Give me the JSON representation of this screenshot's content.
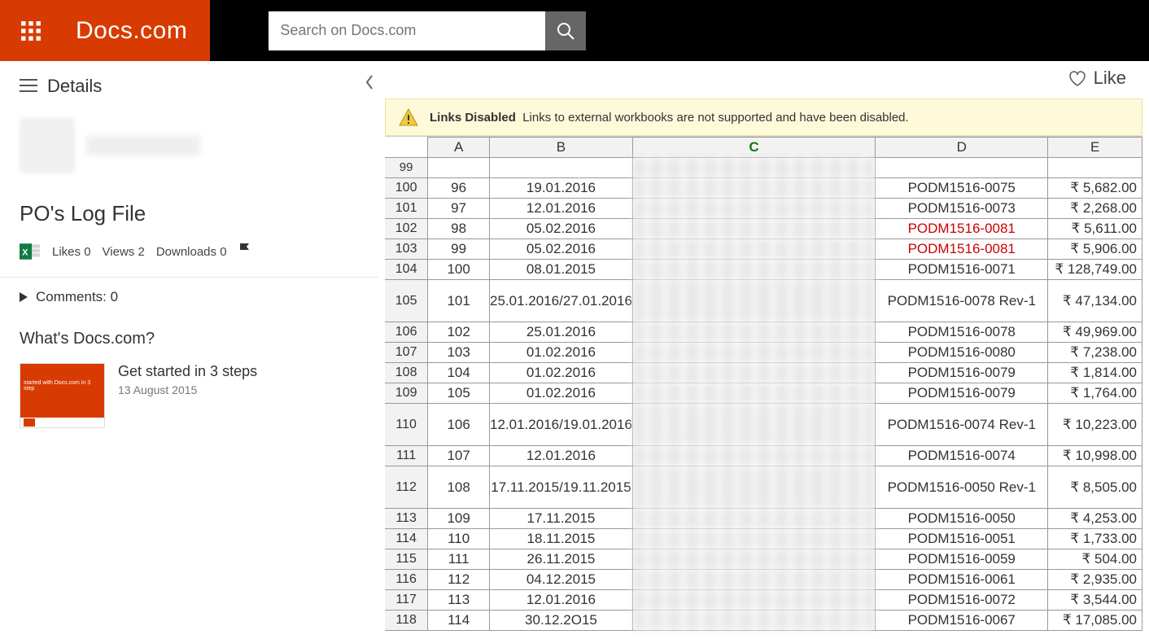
{
  "header": {
    "brand": "Docs.com",
    "search_placeholder": "Search on Docs.com"
  },
  "sidebar": {
    "details_label": "Details",
    "doc_title": "PO's Log File",
    "likes_label": "Likes",
    "likes_count": "0",
    "views_label": "Views",
    "views_count": "2",
    "downloads_label": "Downloads",
    "downloads_count": "0",
    "comments_label": "Comments:",
    "comments_count": "0",
    "whats_label": "What's Docs.com?",
    "promo_title": "Get started in 3 steps",
    "promo_date": "13 August 2015",
    "promo_thumb_text": "started with Docs.com in 3 step"
  },
  "viewer": {
    "like_label": "Like",
    "warning_title": "Links Disabled",
    "warning_text": "Links to external workbooks are not supported and have been disabled."
  },
  "spreadsheet": {
    "columns": [
      "A",
      "B",
      "C",
      "D",
      "E"
    ],
    "rows": [
      {
        "rh": "100",
        "a": "96",
        "b": "19.01.2016",
        "d": "PODM1516-0075",
        "e": "₹ 5,682.00"
      },
      {
        "rh": "101",
        "a": "97",
        "b": "12.01.2016",
        "d": "PODM1516-0073",
        "e": "₹ 2,268.00"
      },
      {
        "rh": "102",
        "a": "98",
        "b": "05.02.2016",
        "d": "PODM1516-0081",
        "e": "₹ 5,611.00",
        "dred": true
      },
      {
        "rh": "103",
        "a": "99",
        "b": "05.02.2016",
        "d": "PODM1516-0081",
        "e": "₹ 5,906.00",
        "dred": true
      },
      {
        "rh": "104",
        "a": "100",
        "b": "08.01.2015",
        "d": "PODM1516-0071",
        "e": "₹ 128,749.00"
      },
      {
        "rh": "105",
        "a": "101",
        "b": "25.01.2016/27.01.2016",
        "d": "PODM1516-0078 Rev-1",
        "e": "₹ 47,134.00",
        "tall": true
      },
      {
        "rh": "106",
        "a": "102",
        "b": "25.01.2016",
        "d": "PODM1516-0078",
        "e": "₹ 49,969.00"
      },
      {
        "rh": "107",
        "a": "103",
        "b": "01.02.2016",
        "d": "PODM1516-0080",
        "e": "₹ 7,238.00"
      },
      {
        "rh": "108",
        "a": "104",
        "b": "01.02.2016",
        "d": "PODM1516-0079",
        "e": "₹ 1,814.00"
      },
      {
        "rh": "109",
        "a": "105",
        "b": "01.02.2016",
        "d": "PODM1516-0079",
        "e": "₹ 1,764.00"
      },
      {
        "rh": "110",
        "a": "106",
        "b": "12.01.2016/19.01.2016",
        "d": "PODM1516-0074 Rev-1",
        "e": "₹ 10,223.00",
        "tall": true
      },
      {
        "rh": "111",
        "a": "107",
        "b": "12.01.2016",
        "d": "PODM1516-0074",
        "e": "₹ 10,998.00"
      },
      {
        "rh": "112",
        "a": "108",
        "b": "17.11.2015/19.11.2015",
        "d": "PODM1516-0050 Rev-1",
        "e": "₹ 8,505.00",
        "tall": true
      },
      {
        "rh": "113",
        "a": "109",
        "b": "17.11.2015",
        "d": "PODM1516-0050",
        "e": "₹ 4,253.00"
      },
      {
        "rh": "114",
        "a": "110",
        "b": "18.11.2015",
        "d": "PODM1516-0051",
        "e": "₹ 1,733.00"
      },
      {
        "rh": "115",
        "a": "111",
        "b": "26.11.2015",
        "d": "PODM1516-0059",
        "e": "₹ 504.00"
      },
      {
        "rh": "116",
        "a": "112",
        "b": "04.12.2015",
        "d": "PODM1516-0061",
        "e": "₹ 2,935.00"
      },
      {
        "rh": "117",
        "a": "113",
        "b": "12.01.2016",
        "d": "PODM1516-0072",
        "e": "₹ 3,544.00"
      },
      {
        "rh": "118",
        "a": "114",
        "b": "30.12.2O15",
        "d": "PODM1516-0067",
        "e": "₹ 17,085.00"
      }
    ],
    "partial_row": {
      "rh": "99"
    }
  }
}
